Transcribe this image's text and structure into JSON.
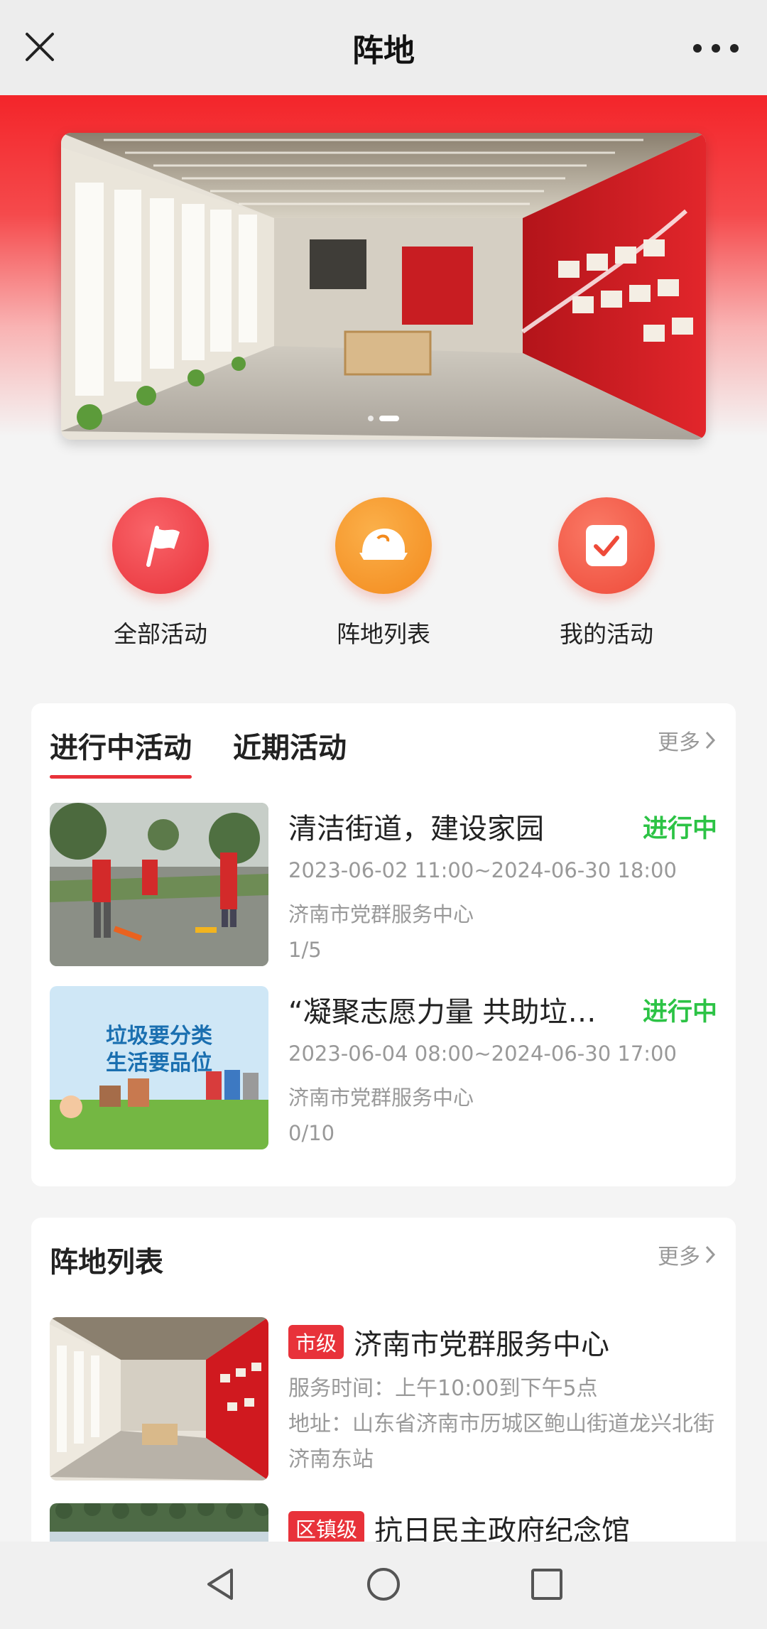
{
  "titlebar": {
    "title": "阵地",
    "close_icon": "close-icon",
    "more_icon": "more-dots-icon"
  },
  "banner": {
    "image": "exhibition-hall-photo",
    "slides": 2,
    "active_slide": 2
  },
  "quick_entries": [
    {
      "label": "全部活动",
      "icon": "flag-icon",
      "color": "#ee3c45"
    },
    {
      "label": "阵地列表",
      "icon": "cap-icon",
      "color": "#f7962a"
    },
    {
      "label": "我的活动",
      "icon": "checkbox-icon",
      "color": "#f0553f"
    }
  ],
  "activities": {
    "tabs": [
      "进行中活动",
      "近期活动"
    ],
    "active_tab": 0,
    "more_label": "更多",
    "items": [
      {
        "title": "清洁街道，建设家园",
        "status": "进行中",
        "time": "2023-06-02 11:00~2024-06-30 18:00",
        "place": "济南市党群服务中心",
        "count": "1/5",
        "image": "volunteers-cleaning-photo"
      },
      {
        "title": "“凝聚志愿力量 共助垃圾分类”",
        "status": "进行中",
        "time": "2023-06-04 08:00~2024-06-30 17:00",
        "place": "济南市党群服务中心",
        "count": "0/10",
        "image": "garbage-sorting-poster",
        "poster_line1": "垃圾要分类",
        "poster_line2": "生活要品位"
      }
    ]
  },
  "positions": {
    "title": "阵地列表",
    "more_label": "更多",
    "items": [
      {
        "level": "市级",
        "name": "济南市党群服务中心",
        "hours": "服务时间：上午10:00到下午5点",
        "address": "地址：山东省济南市历城区鲍山街道龙兴北街济南东站",
        "image": "exhibition-hall-photo"
      },
      {
        "level": "区镇级",
        "name": "抗日民主政府纪念馆",
        "image": "memorial-trees-photo"
      }
    ]
  },
  "navbar": {
    "back_icon": "back-triangle-icon",
    "home_icon": "home-circle-icon",
    "recents_icon": "recents-square-icon"
  },
  "colors": {
    "accent_red": "#e8323a",
    "status_green": "#2cc345"
  }
}
